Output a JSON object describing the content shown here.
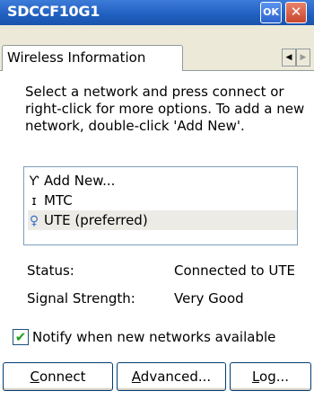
{
  "window": {
    "title": "SDCCF10G1",
    "ok_label": "OK",
    "close_label": "✕"
  },
  "tabs": {
    "active_label": "Wireless Information",
    "scroll_left": "◀",
    "scroll_right": "▶"
  },
  "instructions": "Select a network and press connect or right-click for more options.  To add a new network, double-click 'Add New'.",
  "networks": [
    {
      "icon": "antenna-icon",
      "glyph": "Ƴ",
      "label": "Add New..."
    },
    {
      "icon": "network-icon",
      "glyph": "ɪ",
      "label": "MTC"
    },
    {
      "icon": "preferred-network-icon",
      "glyph": "♀",
      "label": "UTE (preferred)"
    }
  ],
  "status": {
    "status_label": "Status:",
    "status_value": "Connected to UTE",
    "signal_label": "Signal Strength:",
    "signal_value": "Very Good"
  },
  "notify": {
    "checked": true,
    "check_glyph": "✔",
    "label": "Notify when new networks available"
  },
  "buttons": {
    "connect_first": "C",
    "connect_rest": "onnect",
    "advanced_first": "A",
    "advanced_rest": "dvanced...",
    "log_first": "L",
    "log_rest": "og..."
  },
  "colors": {
    "titlebar": "#1f5fbf",
    "check": "#21a121",
    "selected_row": "#ecebe6"
  }
}
